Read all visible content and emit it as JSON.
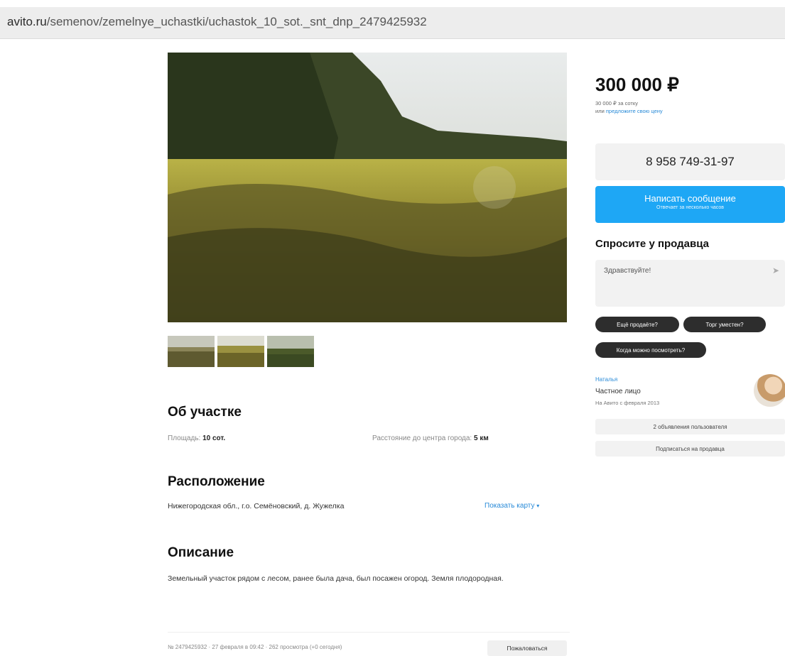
{
  "address_bar": {
    "host": "avito.ru",
    "path": "/semenov/zemelnye_uchastki/uchastok_10_sot._snt_dnp_2479425932"
  },
  "listing": {
    "price": "300 000 ₽",
    "price_per_unit": "30 000 ₽ за сотку",
    "offer_prefix": "или",
    "offer_link": "предложите свою цену",
    "phone": "8 958 749-31-97",
    "message_button": "Написать сообщение",
    "message_button_sub": "Отвечает за несколько часов"
  },
  "ask_seller": {
    "title": "Спросите у продавца",
    "input_placeholder": "Здравствуйте!",
    "chips": [
      "Ещё продаёте?",
      "Торг уместен?",
      "Когда можно посмотреть?"
    ]
  },
  "seller": {
    "name": "Наталья",
    "type": "Частное лицо",
    "since": "На Авито с февраля 2013",
    "listings_button": "2 объявления пользователя",
    "subscribe_button": "Подписаться на продавца"
  },
  "about": {
    "title": "Об участке",
    "area_label": "Площадь:",
    "area_value": "10 сот.",
    "distance_label": "Расстояние до центра города:",
    "distance_value": "5 км"
  },
  "location": {
    "title": "Расположение",
    "address": "Нижегородская обл., г.о. Семёновский, д. Жужелка",
    "map_link": "Показать карту"
  },
  "description": {
    "title": "Описание",
    "text": "Земельный участок рядом с лесом, ранее была дача, был посажен огород. Земля плодородная."
  },
  "footer": {
    "meta": "№ 2479425932 · 27 февраля в 09:42 · 262 просмотра (+0 сегодня)",
    "report_button": "Пожаловаться"
  }
}
